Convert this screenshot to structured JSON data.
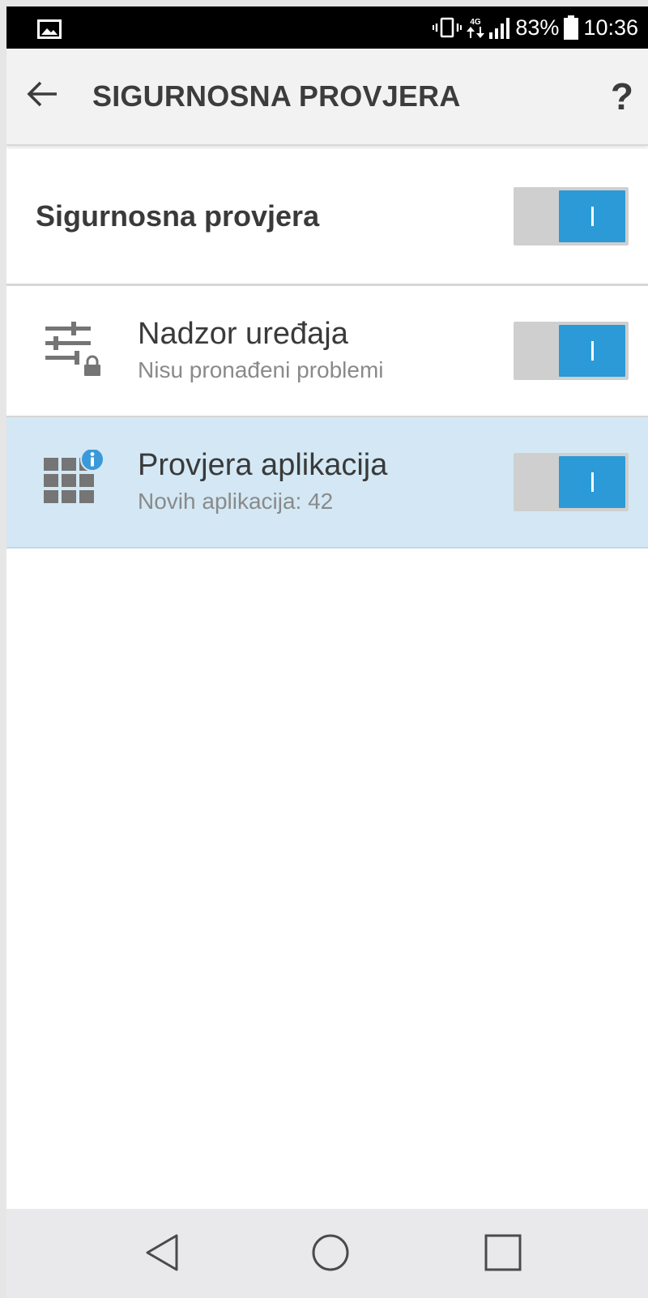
{
  "status_bar": {
    "network_label": "4G",
    "battery": "83%",
    "time": "10:36",
    "icons": [
      "gallery-icon",
      "vibrate-icon",
      "data-arrows-icon",
      "signal-icon",
      "battery-icon"
    ]
  },
  "app_bar": {
    "title": "SIGURNOSNA PROVJERA",
    "back_icon": "arrow-left-icon",
    "help_label": "?"
  },
  "master": {
    "label": "Sigurnosna provjera",
    "enabled": true
  },
  "items": [
    {
      "title": "Nadzor uređaja",
      "subtitle": "Nisu pronađeni problemi",
      "icon": "sliders-lock-icon",
      "enabled": true,
      "highlighted": false
    },
    {
      "title": "Provjera aplikacija",
      "subtitle": "Novih aplikacija: 42",
      "icon": "app-grid-info-icon",
      "enabled": true,
      "highlighted": true
    }
  ],
  "nav_bar": {
    "buttons": [
      "back-triangle-icon",
      "home-circle-icon",
      "recents-square-icon"
    ]
  },
  "colors": {
    "accent": "#2b9ad6",
    "highlight_row": "#d3e8f4",
    "app_bar": "#f2f2f2",
    "toggle_track": "#cfcfcf"
  }
}
